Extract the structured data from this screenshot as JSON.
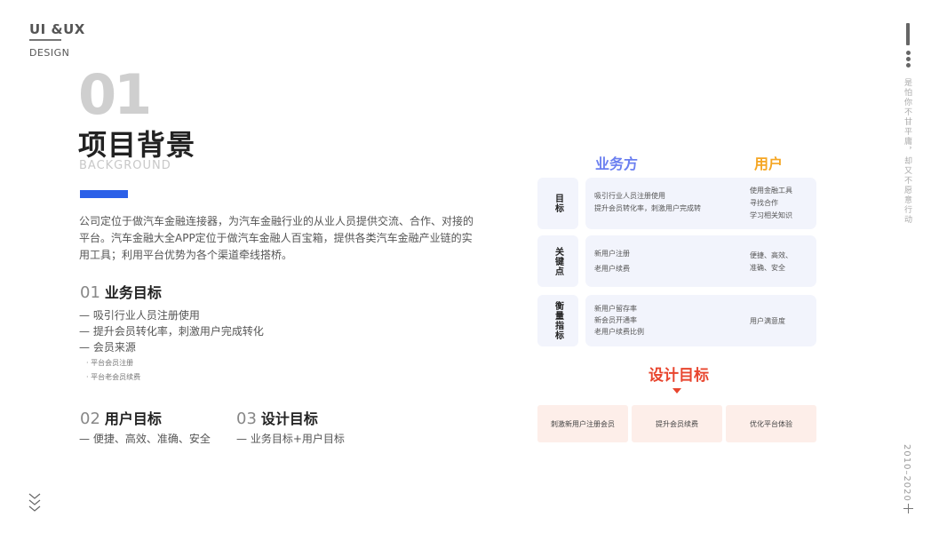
{
  "logo": {
    "title": "UI &UX",
    "subtitle": "DESIGN"
  },
  "header": {
    "number": "01",
    "title": "项目背景",
    "title_en": "BACKGROUND"
  },
  "intro": "公司定位于做汽车金融连接器，为汽车金融行业的从业人员提供交流、合作、对接的平台。汽车金融大全APP定位于做汽车金融人百宝箱，提供各类汽车金融产业链的实用工具；利用平台优势为各个渠道牵线搭桥。",
  "sections": {
    "business": {
      "num": "01",
      "label": "业务目标",
      "items": [
        "— 吸引行业人员注册使用",
        "— 提升会员转化率，刺激用户完成转化",
        "— 会员来源"
      ],
      "sub_items": [
        "· 平台会员注册",
        "· 平台老会员续费"
      ]
    },
    "user": {
      "num": "02",
      "label": "用户目标",
      "items": [
        "— 便捷、高效、准确、安全"
      ]
    },
    "design": {
      "num": "03",
      "label": "设计目标",
      "items": [
        "— 业务目标+用户目标"
      ]
    }
  },
  "diagram": {
    "col_business": "业务方",
    "col_user": "用户",
    "colors": {
      "business": "#6b7ff0",
      "user": "#f5a623",
      "goal": "#e8452e",
      "card_bg": "#f2f4fc",
      "goal_bg": "#fdeee9",
      "accent": "#2b60e8"
    },
    "rows": [
      {
        "label": "目标",
        "business": [
          "吸引行业人员注册使用",
          "提升会员转化率，刺激用户完成转"
        ],
        "user": [
          "使用金融工具",
          "寻找合作",
          "学习相关知识"
        ]
      },
      {
        "label": "关键点",
        "business": [
          "新用户注册",
          "老用户续费"
        ],
        "user": [
          "便捷、高效、",
          "准确、安全"
        ]
      },
      {
        "label": "衡量指标",
        "business": [
          "新用户留存率",
          "新会员开通率",
          "老用户续费比例"
        ],
        "user": [
          "用户满意度"
        ]
      }
    ],
    "goal_title": "设计目标",
    "goals": [
      "刺激新用户注册会员",
      "提升会员续费",
      "优化平台体验"
    ]
  },
  "side": {
    "vertical_text": "是怕你不甘平庸，却又不愿意行动",
    "years": "2010–2020"
  }
}
